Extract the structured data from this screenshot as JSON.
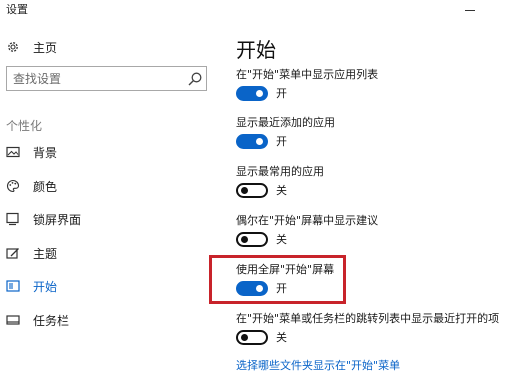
{
  "window": {
    "title": "设置"
  },
  "sidebar": {
    "home_label": "主页",
    "search_placeholder": "查找设置",
    "section_label": "个性化",
    "items": [
      {
        "label": "背景",
        "icon": "picture-icon"
      },
      {
        "label": "颜色",
        "icon": "palette-icon"
      },
      {
        "label": "锁屏界面",
        "icon": "lock-screen-icon"
      },
      {
        "label": "主题",
        "icon": "theme-icon"
      },
      {
        "label": "开始",
        "icon": "start-icon",
        "active": true
      },
      {
        "label": "任务栏",
        "icon": "taskbar-icon"
      }
    ]
  },
  "main": {
    "title": "开始",
    "settings": [
      {
        "label": "在\"开始\"菜单中显示应用列表",
        "state": "on",
        "state_label": "开"
      },
      {
        "label": "显示最近添加的应用",
        "state": "on",
        "state_label": "开"
      },
      {
        "label": "显示最常用的应用",
        "state": "off",
        "state_label": "关"
      },
      {
        "label": "偶尔在\"开始\"屏幕中显示建议",
        "state": "off",
        "state_label": "关"
      },
      {
        "label": "使用全屏\"开始\"屏幕",
        "state": "on",
        "state_label": "开",
        "highlighted": true
      },
      {
        "label": "在\"开始\"菜单或任务栏的跳转列表中显示最近打开的项",
        "state": "off",
        "state_label": "关"
      }
    ],
    "link": "选择哪些文件夹显示在\"开始\"菜单"
  },
  "colors": {
    "accent": "#0a64c8",
    "highlight": "#c8232a"
  }
}
